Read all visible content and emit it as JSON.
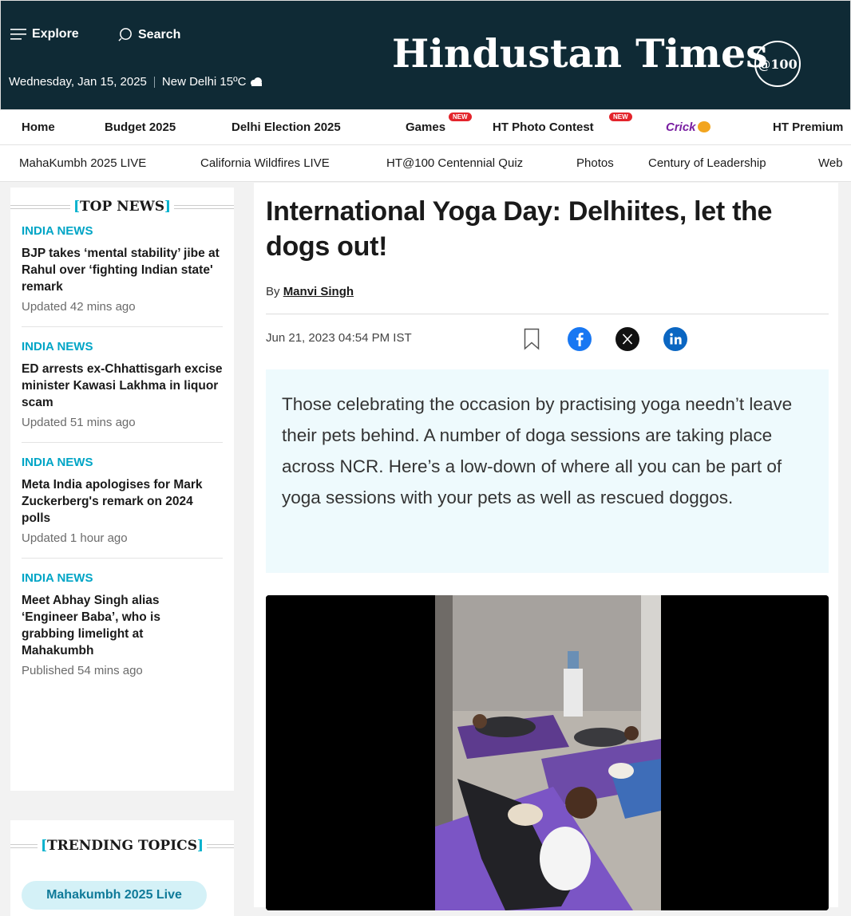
{
  "masthead": {
    "explore_label": "Explore",
    "search_label": "Search",
    "date": "Wednesday, Jan 15, 2025",
    "weather": "New Delhi 15ºC",
    "logo": "Hindustan Times",
    "seal": "@100"
  },
  "primary_nav": [
    {
      "label": "Home"
    },
    {
      "label": "Budget 2025"
    },
    {
      "label": "Delhi Election 2025"
    },
    {
      "label": "Games",
      "badge": "NEW"
    },
    {
      "label": "HT Photo Contest",
      "badge": "NEW"
    },
    {
      "label": "Crick"
    },
    {
      "label": "HT Premium"
    }
  ],
  "secondary_nav": [
    {
      "label": "MahaKumbh 2025 LIVE"
    },
    {
      "label": "California Wildfires LIVE"
    },
    {
      "label": "HT@100 Centennial Quiz"
    },
    {
      "label": "Photos"
    },
    {
      "label": "Century of Leadership"
    },
    {
      "label": "Web"
    }
  ],
  "top_news": {
    "heading_open": "[",
    "heading": "TOP NEWS",
    "heading_close": "]",
    "items": [
      {
        "category": "INDIA NEWS",
        "headline": "BJP takes ‘mental stability’ jibe at Rahul over ‘fighting Indian state' remark",
        "time": "Updated 42 mins ago"
      },
      {
        "category": "INDIA NEWS",
        "headline": "ED arrests ex-Chhattisgarh excise minister Kawasi Lakhma in liquor scam",
        "time": "Updated 51 mins ago"
      },
      {
        "category": "INDIA NEWS",
        "headline": "Meta India apologises for Mark Zuckerberg's remark on 2024 polls",
        "time": "Updated 1 hour ago"
      },
      {
        "category": "INDIA NEWS",
        "headline": "Meet Abhay Singh alias ‘Engineer Baba’, who is grabbing limelight at Mahakumbh",
        "time": "Published 54 mins ago"
      }
    ]
  },
  "trending": {
    "heading_open": "[",
    "heading": "TRENDING TOPICS",
    "heading_close": "]",
    "pill": "Mahakumbh 2025 Live"
  },
  "article": {
    "title": "International Yoga Day: Delhiites, let the dogs out!",
    "by_prefix": "By",
    "author": "Manvi Singh",
    "published": "Jun 21, 2023 04:54 PM IST",
    "summary": "Those celebrating the occasion by practising yoga needn’t leave their pets behind. A number of doga sessions are taking place across NCR. Here’s a low-down of where all you can be part of yoga sessions with your pets as well as rescued doggos."
  },
  "share_icons": [
    "bookmark-icon",
    "facebook-icon",
    "x-icon",
    "linkedin-icon"
  ],
  "colors": {
    "masthead_bg": "#0f2a35",
    "accent": "#00a5c6",
    "badge": "#e3242b",
    "summary_bg": "#eefafd",
    "facebook": "#1877f2",
    "linkedin": "#0a66c2"
  }
}
